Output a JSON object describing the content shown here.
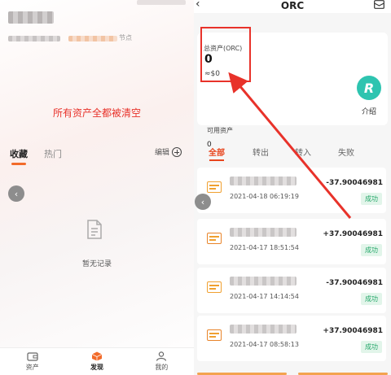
{
  "left": {
    "node_tag": "节点",
    "cleared_message": "所有资产全都被清空",
    "tabs": [
      {
        "label": "收藏",
        "active": true
      },
      {
        "label": "热门",
        "active": false
      }
    ],
    "edit_label": "编辑",
    "empty_text": "暂无记录",
    "nav": [
      {
        "label": "资产",
        "icon": "wallet-icon",
        "active": false
      },
      {
        "label": "发现",
        "icon": "cube-icon",
        "active": true
      },
      {
        "label": "我的",
        "icon": "user-icon",
        "active": false
      }
    ]
  },
  "right": {
    "title": "ORC",
    "total_asset_label": "总资产(ORC)",
    "total_asset_value": "0",
    "total_asset_usd": "≈$0",
    "coin_logo_letter": "R",
    "intro_label": "介绍",
    "available_label": "可用资产",
    "available_value": "0",
    "tabs": [
      {
        "label": "全部",
        "active": true
      },
      {
        "label": "转出",
        "active": false
      },
      {
        "label": "转入",
        "active": false
      },
      {
        "label": "失败",
        "active": false
      }
    ],
    "transactions": [
      {
        "direction": "out",
        "date": "2021-04-18 06:19:19",
        "amount": "-37.90046981",
        "status": "成功"
      },
      {
        "direction": "in",
        "date": "2021-04-17 18:51:54",
        "amount": "+37.90046981",
        "status": "成功"
      },
      {
        "direction": "out",
        "date": "2021-04-17 14:14:54",
        "amount": "-37.90046981",
        "status": "成功"
      },
      {
        "direction": "in",
        "date": "2021-04-17 08:58:13",
        "amount": "+37.90046981",
        "status": "成功"
      }
    ]
  },
  "colors": {
    "accent": "#e8451d",
    "highlight": "#e8322a",
    "success": "#26a86b",
    "coin": "#2ec4b0"
  }
}
